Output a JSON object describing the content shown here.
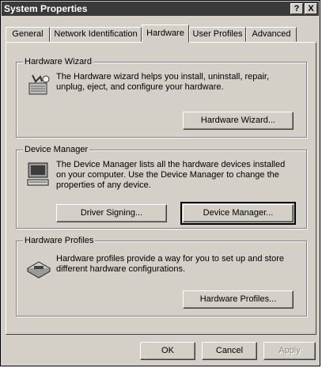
{
  "window": {
    "title": "System Properties",
    "help_button": "?",
    "close_button": "X"
  },
  "tabs": [
    {
      "label": "General"
    },
    {
      "label": "Network Identification"
    },
    {
      "label": "Hardware",
      "active": true
    },
    {
      "label": "User Profiles"
    },
    {
      "label": "Advanced"
    }
  ],
  "hardware_wizard": {
    "legend": "Hardware Wizard",
    "icon": "hardware-wizard-icon",
    "description": "The Hardware wizard helps you install, uninstall, repair, unplug, eject, and configure your hardware.",
    "button": "Hardware Wizard..."
  },
  "device_manager": {
    "legend": "Device Manager",
    "icon": "computer-icon",
    "description": "The Device Manager lists all the hardware devices installed on your computer. Use the Device Manager to change the properties of any device.",
    "driver_signing_button": "Driver Signing...",
    "device_manager_button": "Device Manager..."
  },
  "hardware_profiles": {
    "legend": "Hardware Profiles",
    "icon": "hardware-profiles-icon",
    "description": "Hardware profiles provide a way for you to set up and store different hardware configurations.",
    "button": "Hardware Profiles..."
  },
  "footer": {
    "ok": "OK",
    "cancel": "Cancel",
    "apply": "Apply"
  }
}
